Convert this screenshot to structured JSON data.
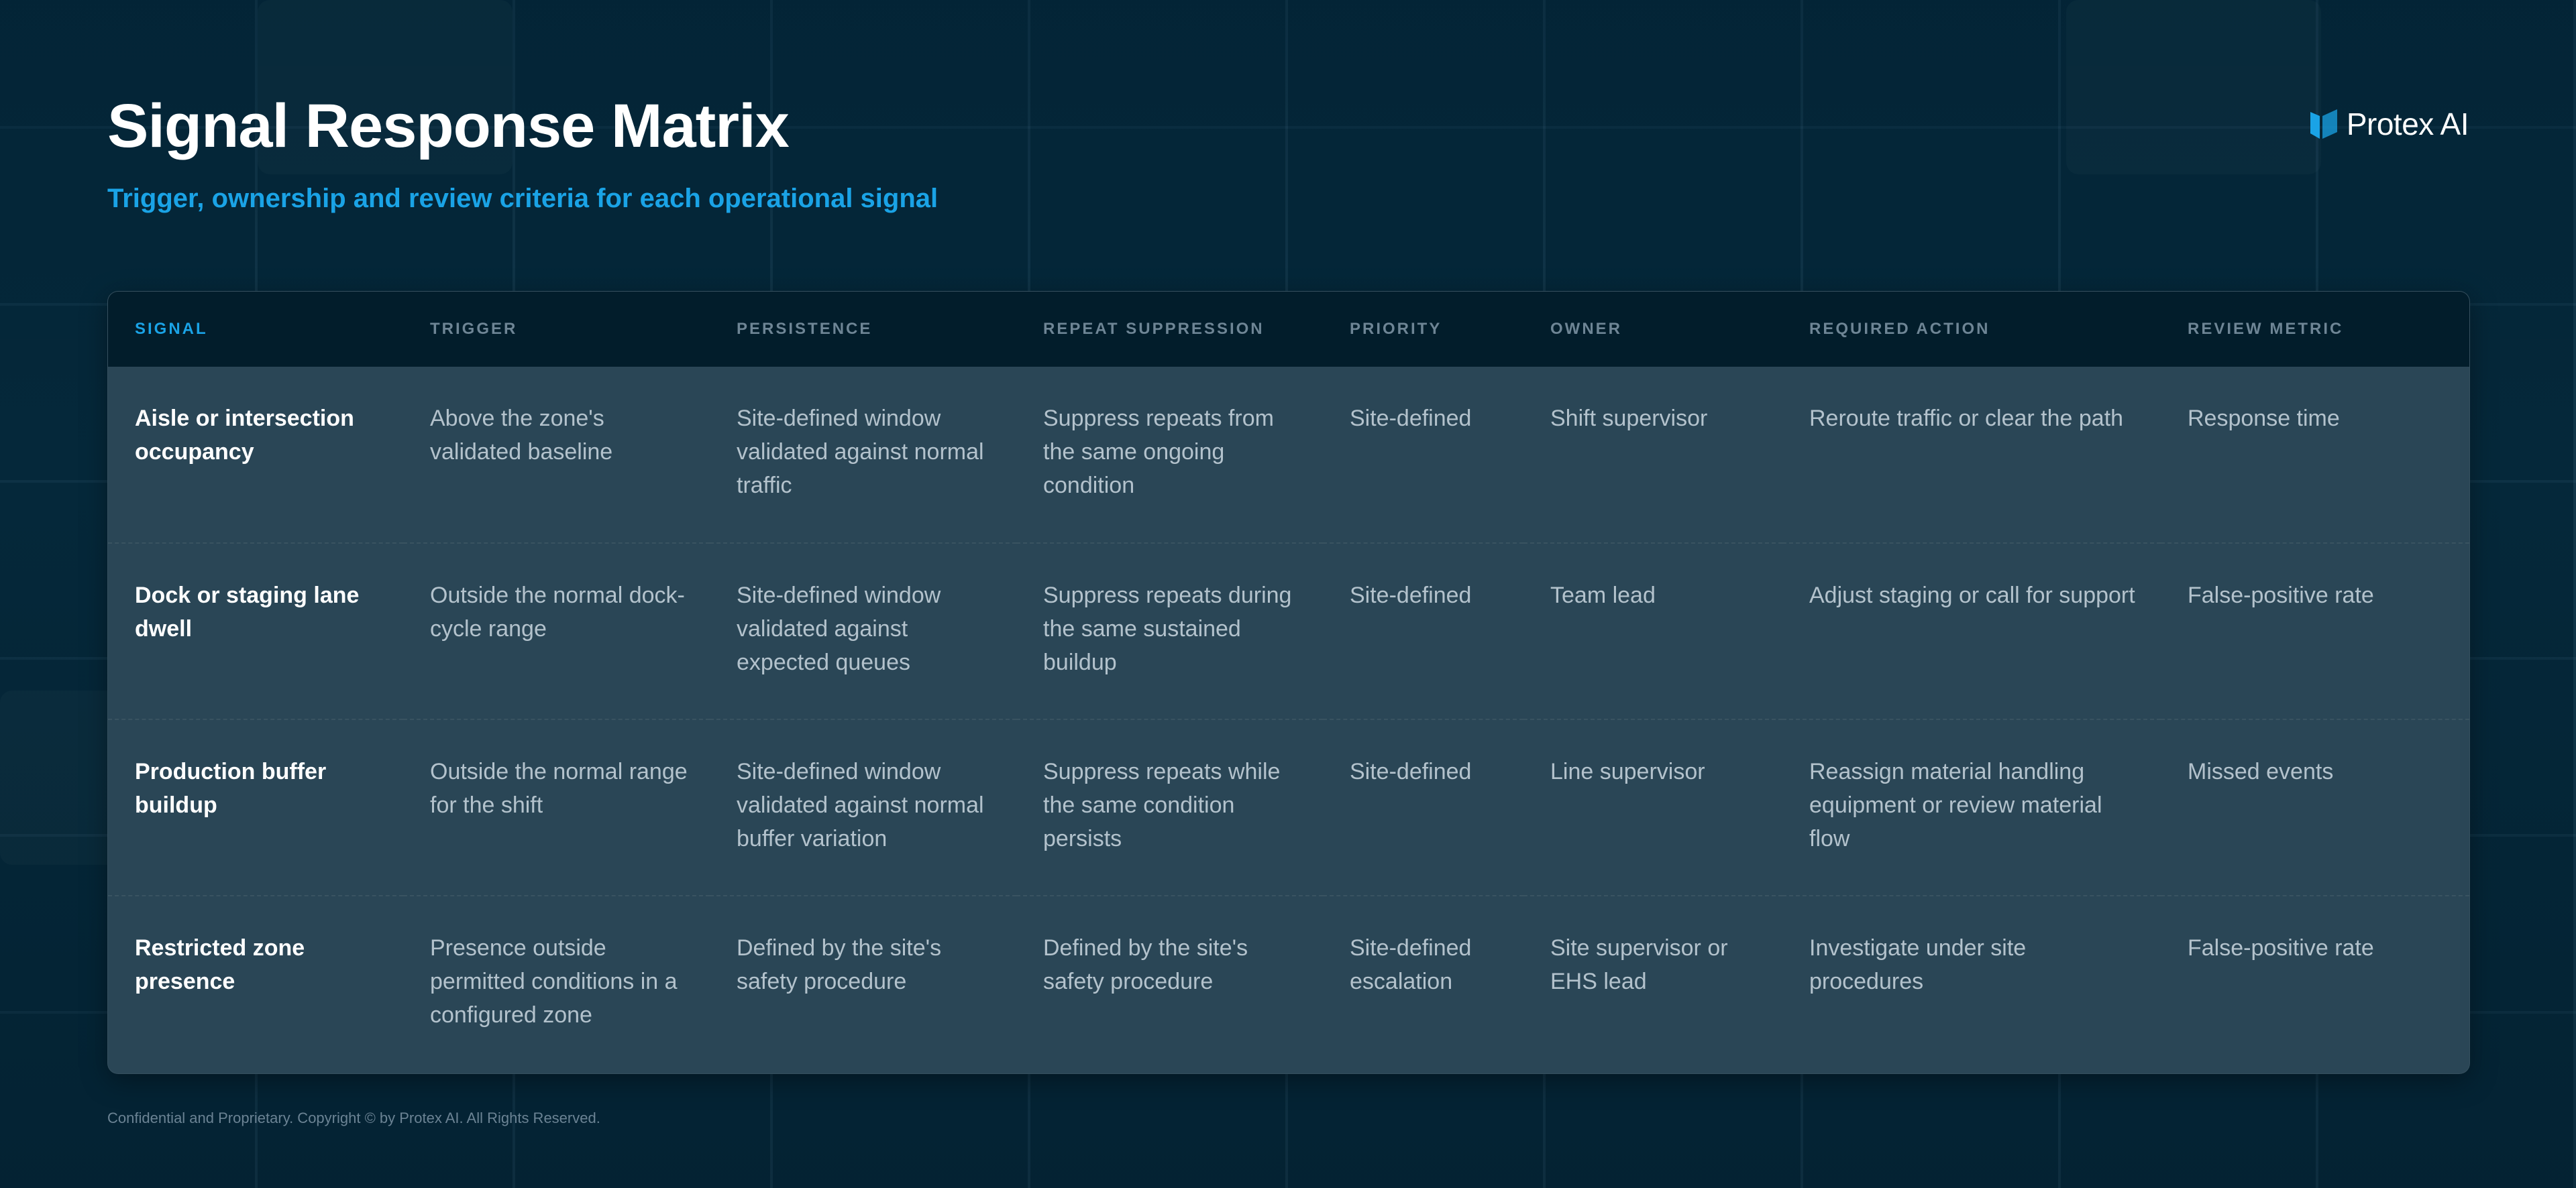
{
  "header": {
    "title": "Signal Response Matrix",
    "subtitle": "Trigger, ownership and review criteria for each operational signal"
  },
  "brand": {
    "logo_text": "Protex AI",
    "logo_icon": "protex-shield-mark"
  },
  "colors": {
    "accent": "#1aa3e6",
    "background": "#05283a",
    "table_body": "#2a4656",
    "table_header": "#021d2b"
  },
  "table": {
    "columns": [
      "SIGNAL",
      "TRIGGER",
      "PERSISTENCE",
      "REPEAT SUPPRESSION",
      "PRIORITY",
      "OWNER",
      "REQUIRED ACTION",
      "REVIEW METRIC"
    ],
    "rows": [
      [
        "Aisle or intersection occupancy",
        "Above the zone's validated baseline",
        "Site-defined window validated against normal traffic",
        "Suppress repeats from the same ongoing condition",
        "Site-defined",
        "Shift supervisor",
        "Reroute traffic or clear the path",
        "Response time"
      ],
      [
        "Dock or staging lane dwell",
        "Outside the normal dock-cycle range",
        "Site-defined window validated against expected queues",
        "Suppress repeats during the same sustained buildup",
        "Site-defined",
        "Team lead",
        "Adjust staging or call for support",
        "False-positive rate"
      ],
      [
        "Production buffer buildup",
        "Outside the normal range for the shift",
        "Site-defined window validated against normal buffer variation",
        "Suppress repeats while the same condition persists",
        "Site-defined",
        "Line supervisor",
        "Reassign material handling equipment or review material flow",
        "Missed events"
      ],
      [
        "Restricted zone presence",
        "Presence outside permitted conditions in a configured zone",
        "Defined by the site's safety procedure",
        "Defined by the site's safety procedure",
        "Site-defined escalation",
        "Site supervisor or EHS lead",
        "Investigate under site procedures",
        "False-positive rate"
      ]
    ]
  },
  "footer": {
    "text": "Confidential and Proprietary. Copyright © by Protex AI. All Rights Reserved."
  }
}
